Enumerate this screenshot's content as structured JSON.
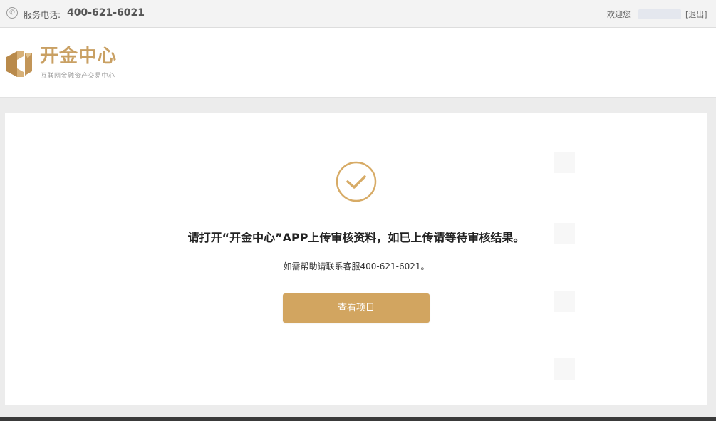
{
  "topbar": {
    "phone_icon": "phone-icon",
    "service_label": "服务电话:",
    "service_phone": "400-621-6021",
    "welcome": "欢迎您",
    "logout": "[退出]"
  },
  "header": {
    "logo_title": "开金中心",
    "logo_subtitle": "互联网金融资产交易中心"
  },
  "main": {
    "status_icon": "check-circle-icon",
    "message": "请打开“开金中心”APP上传审核资料，如已上传请等待审核结果。",
    "help": "如需帮助请联系客服400-621-6021。",
    "button_label": "查看项目"
  },
  "colors": {
    "brand": "#c9a063",
    "button": "#d2a560",
    "page_background": "#ececec"
  }
}
